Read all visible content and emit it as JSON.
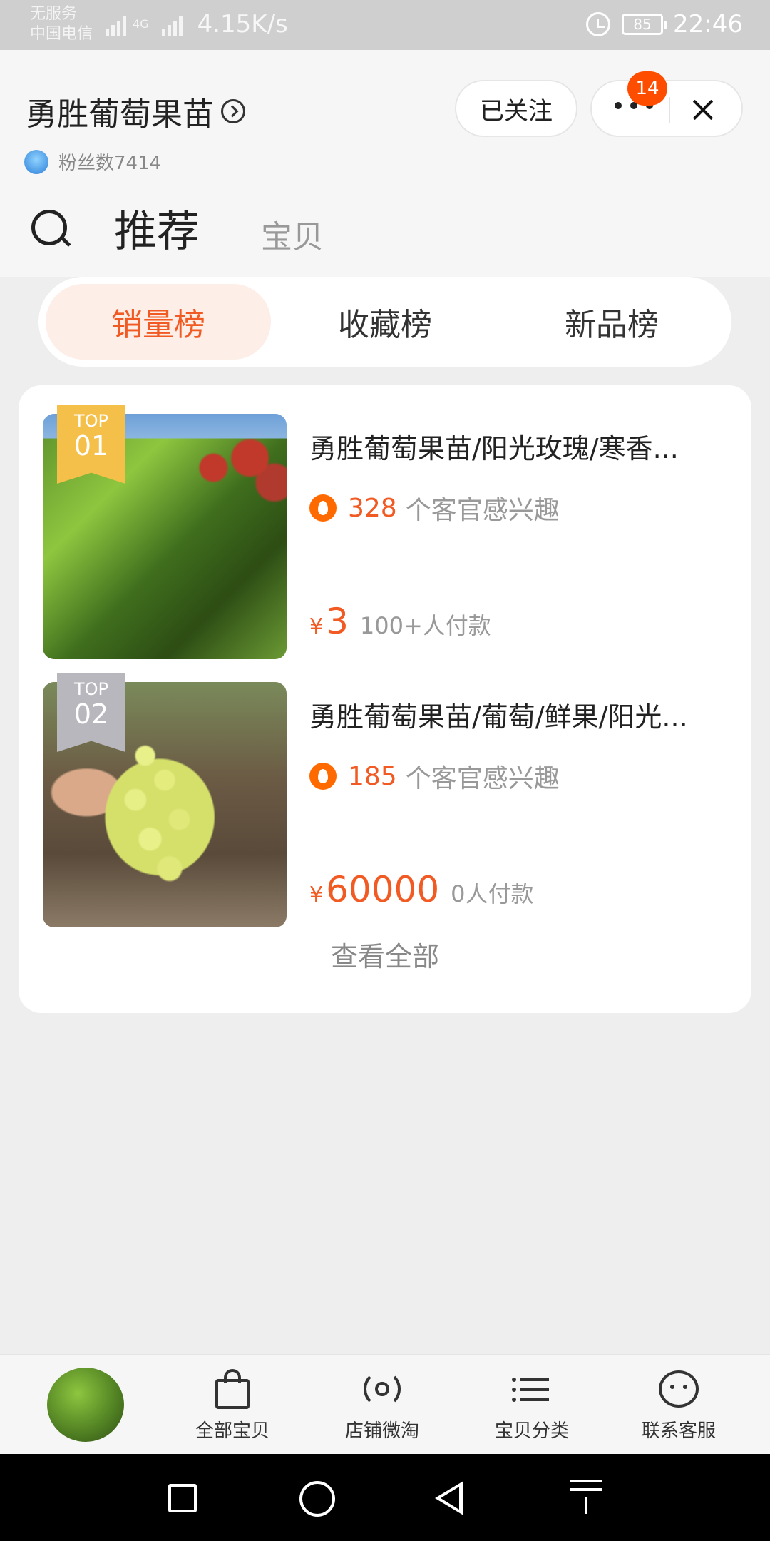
{
  "status_bar": {
    "carrier_line1": "无服务",
    "carrier_line2": "中国电信",
    "network_type": "4G",
    "net_speed": "4.15K/s",
    "battery": "85",
    "time": "22:46"
  },
  "header": {
    "store_name": "勇胜葡萄果苗",
    "fans_label": "粉丝数7414",
    "follow_label": "已关注",
    "badge_count": "14"
  },
  "nav_tabs": {
    "recommend": "推荐",
    "products": "宝贝"
  },
  "ranking_tabs": [
    {
      "label": "销量榜",
      "active": true
    },
    {
      "label": "收藏榜",
      "active": false
    },
    {
      "label": "新品榜",
      "active": false
    }
  ],
  "items": [
    {
      "rank_top": "TOP",
      "rank_num": "01",
      "title": "勇胜葡萄果苗/阳光玫瑰/寒香...",
      "interest_count": "328",
      "interest_label": "个客官感兴趣",
      "currency": "¥",
      "price": "3",
      "paid": "100+人付款"
    },
    {
      "rank_top": "TOP",
      "rank_num": "02",
      "title": "勇胜葡萄果苗/葡萄/鲜果/阳光...",
      "interest_count": "185",
      "interest_label": "个客官感兴趣",
      "currency": "¥",
      "price": "60000",
      "paid": "0人付款"
    }
  ],
  "view_all": "查看全部",
  "bottom_tabs": [
    {
      "label": "全部宝贝",
      "icon": "shopping-bag-icon"
    },
    {
      "label": "店铺微淘",
      "icon": "broadcast-icon"
    },
    {
      "label": "宝贝分类",
      "icon": "list-icon"
    },
    {
      "label": "联系客服",
      "icon": "chat-face-icon"
    }
  ],
  "colors": {
    "accent": "#f15a22",
    "badge": "#ff4d00",
    "active_tab_bg": "#fdeee7",
    "rank_gold": "#f5c04a",
    "rank_silver": "#b7b7bd"
  }
}
